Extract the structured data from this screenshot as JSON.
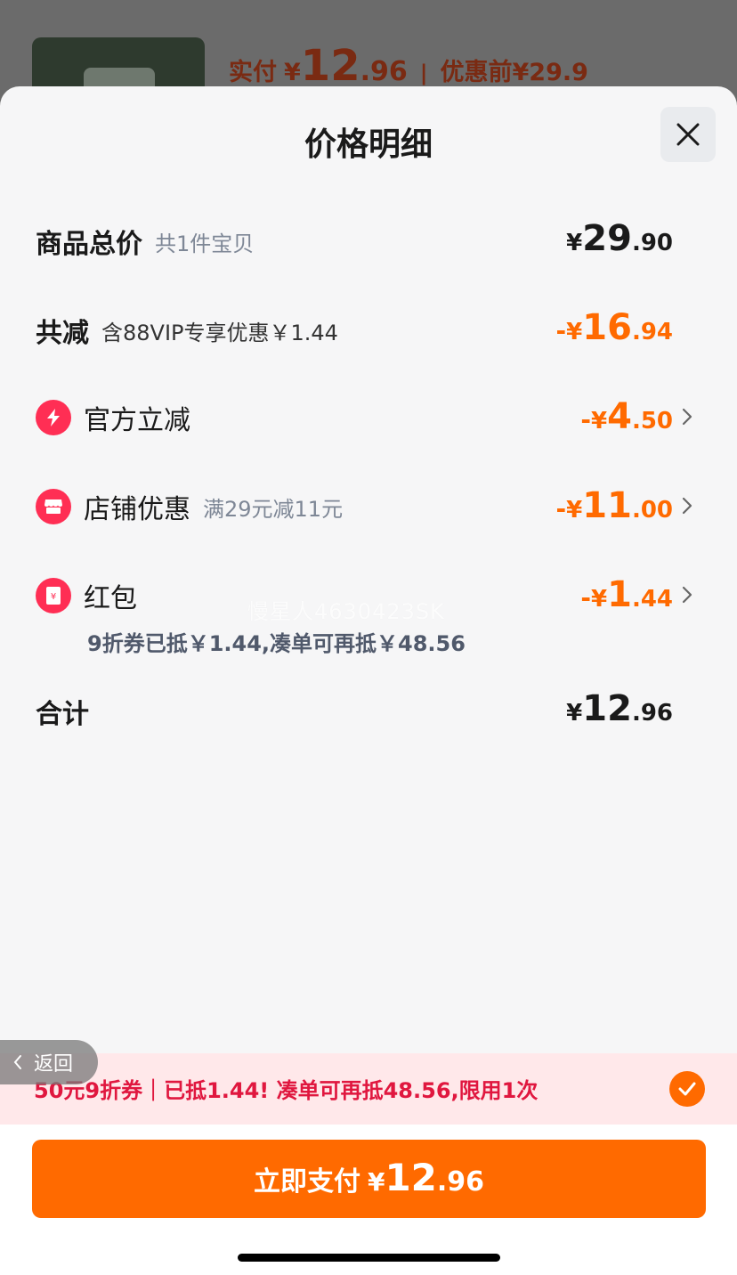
{
  "background": {
    "paid_label": "实付",
    "yen": "¥",
    "paid_int": "12",
    "paid_dec": ".96",
    "separator": "|",
    "original_price": "优惠前¥29.9"
  },
  "sheet": {
    "title": "价格明细"
  },
  "rows": {
    "total": {
      "label": "商品总价",
      "sub": "共1件宝贝",
      "yen": "¥",
      "int": "29",
      "dec": ".90"
    },
    "discount": {
      "label": "共减",
      "sub": "含88VIP专享优惠￥1.44",
      "prefix": "-",
      "yen": "¥",
      "int": "16",
      "dec": ".94"
    },
    "official": {
      "label": "官方立减",
      "prefix": "-",
      "yen": "¥",
      "int": "4",
      "dec": ".50"
    },
    "store": {
      "label": "店铺优惠",
      "sub": "满29元减11元",
      "prefix": "-",
      "yen": "¥",
      "int": "11",
      "dec": ".00"
    },
    "redpacket": {
      "label": "红包",
      "prefix": "-",
      "yen": "¥",
      "int": "1",
      "dec": ".44",
      "note": "9折券已抵￥1.44,凑单可再抵￥48.56"
    },
    "sum": {
      "label": "合计",
      "yen": "¥",
      "int": "12",
      "dec": ".96"
    }
  },
  "watermark": "慢星人4630423SK",
  "promo": {
    "text": "50元9折券｜已抵1.44! 凑单可再抵48.56,限用1次",
    "checked": true
  },
  "back": {
    "label": "返回"
  },
  "pay": {
    "label": "立即支付",
    "yen": "¥",
    "int": "12",
    "dec": ".96"
  },
  "colors": {
    "accent": "#ff6a00",
    "red": "#ff2e54",
    "promo_text": "#e0173f"
  }
}
